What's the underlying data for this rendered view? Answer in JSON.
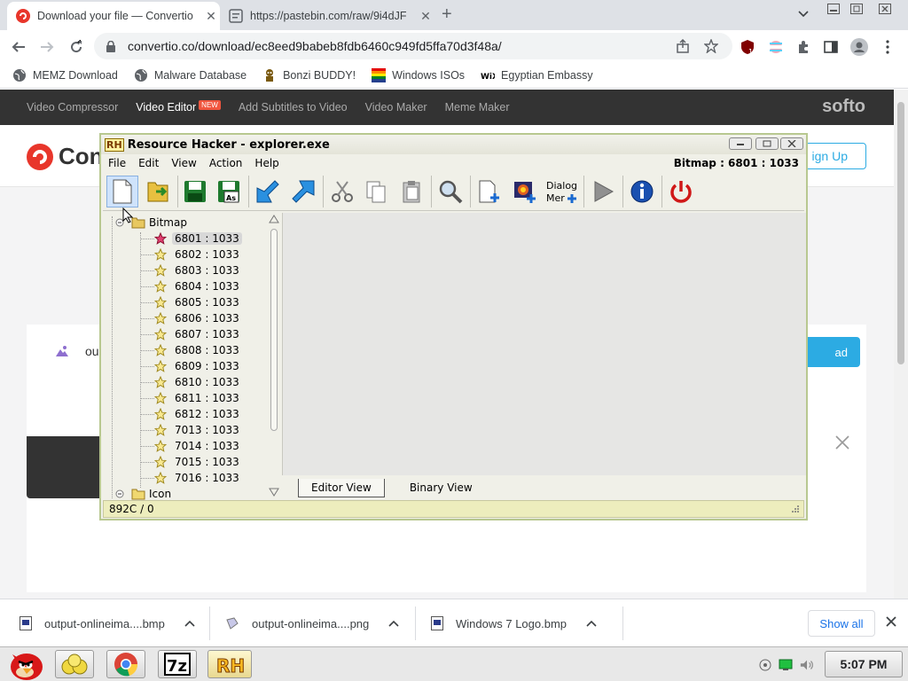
{
  "browser": {
    "tabs": [
      {
        "title": "Download your file — Convertio",
        "icon": "convertio-icon",
        "active": true
      },
      {
        "title": "https://pastebin.com/raw/9i4dJF",
        "icon": "pastebin-icon",
        "active": false
      }
    ],
    "url": "convertio.co/download/ec8eed9babeb8fdb6460c949fd5ffa70d3f48a/",
    "extension_badge": "1",
    "bookmarks": [
      {
        "label": "MEMZ Download",
        "icon": "globe-icon"
      },
      {
        "label": "Malware Database",
        "icon": "globe-icon"
      },
      {
        "label": "Bonzi BUDDY!",
        "icon": "bonzi-icon"
      },
      {
        "label": "Windows ISOs",
        "icon": "windows-flag-icon"
      },
      {
        "label": "Egyptian Embassy",
        "icon": "wix-icon"
      }
    ]
  },
  "site": {
    "nav": [
      "Video Compressor",
      "Video Editor",
      "Add Subtitles to Video",
      "Video Maker",
      "Meme Maker"
    ],
    "nav_badge": "NEW",
    "brand": "softo",
    "logo_text": "Con",
    "signup_label": "ign Up",
    "file_label": "ou",
    "download_label": "ad"
  },
  "reshacker": {
    "title": "Resource Hacker - explorer.exe",
    "logo": "RH",
    "menu": [
      "File",
      "Edit",
      "View",
      "Action",
      "Help"
    ],
    "status_right": "Bitmap : 6801 : 1033",
    "toolbar": [
      "new-file-icon",
      "open-icon",
      "save-icon",
      "save-as-icon",
      "compile-icon",
      "export-icon",
      "cut-icon",
      "copy-icon",
      "paste-icon",
      "find-icon",
      "add-resource-icon",
      "add-image-icon",
      "dialog-menu-icon",
      "play-icon",
      "info-icon",
      "power-icon"
    ],
    "dialog_label_1": "Dialog",
    "dialog_label_2": "Mer",
    "tree": {
      "root": "Bitmap",
      "items": [
        "6801 : 1033",
        "6802 : 1033",
        "6803 : 1033",
        "6804 : 1033",
        "6805 : 1033",
        "6806 : 1033",
        "6807 : 1033",
        "6808 : 1033",
        "6809 : 1033",
        "6810 : 1033",
        "6811 : 1033",
        "6812 : 1033",
        "7013 : 1033",
        "7014 : 1033",
        "7015 : 1033",
        "7016 : 1033"
      ],
      "next": "Icon"
    },
    "view_tabs": [
      "Editor View",
      "Binary View"
    ],
    "status_left": "892C / 0"
  },
  "downloads": {
    "items": [
      {
        "name": "output-onlineima....bmp"
      },
      {
        "name": "output-onlineima....png"
      },
      {
        "name": "Windows 7 Logo.bmp"
      }
    ],
    "show_all": "Show all"
  },
  "taskbar": {
    "apps": [
      "angry-bird-start-icon",
      "yellow-folder-app-icon",
      "chrome-icon",
      "7zip-icon",
      "resource-hacker-icon"
    ],
    "sevenzip_label": "7z",
    "rh_label": "RH",
    "clock": "5:07 PM"
  }
}
